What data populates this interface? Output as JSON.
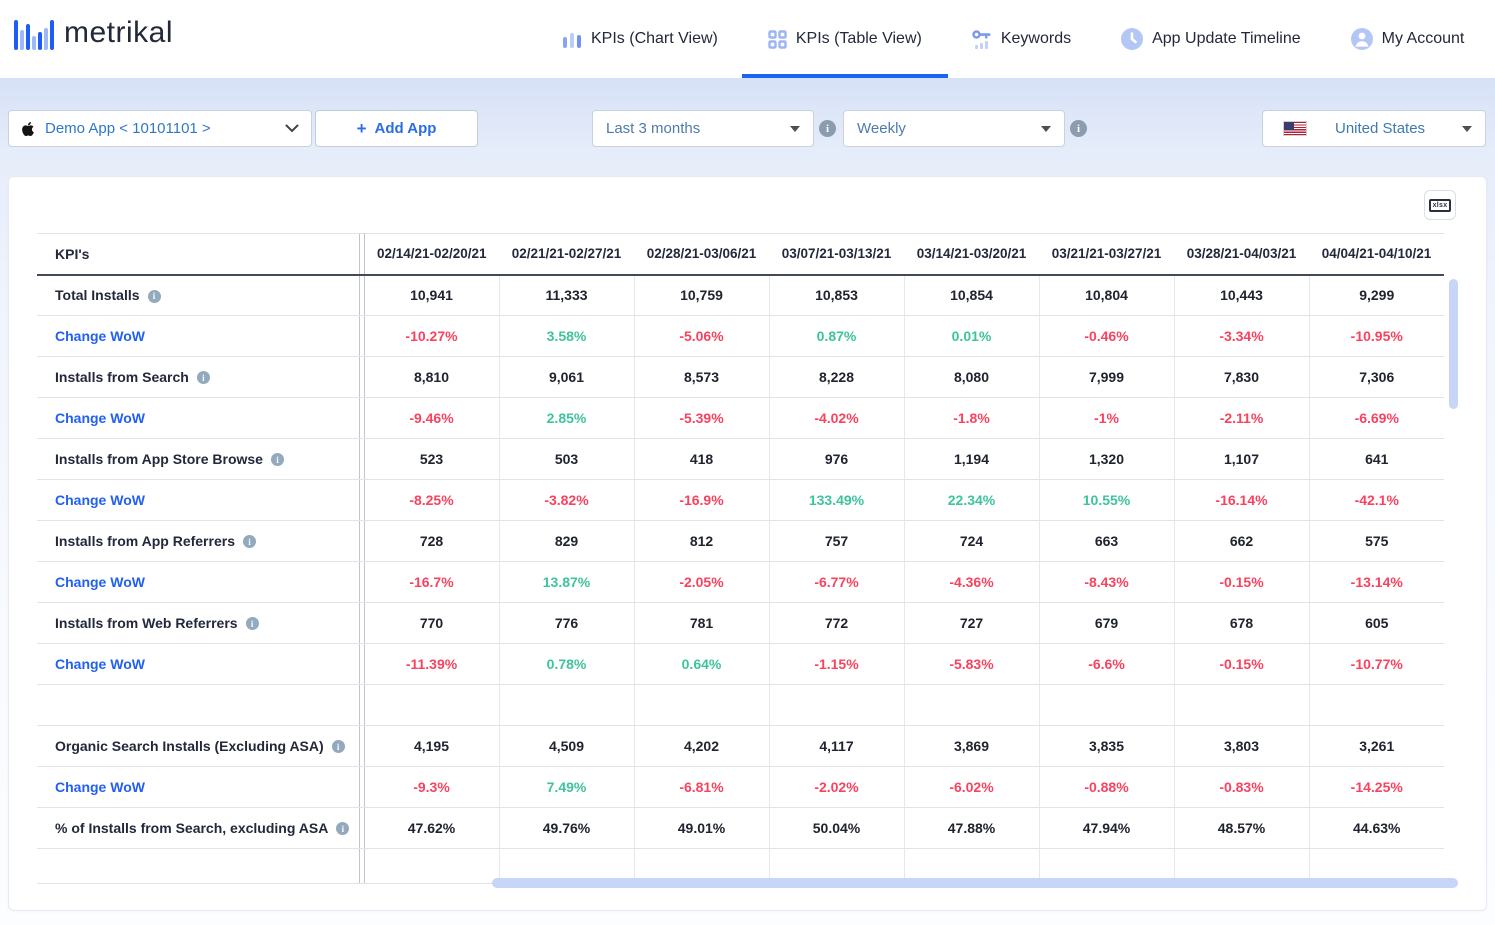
{
  "colors": {
    "accent": "#1b63f2",
    "link": "#2160f0",
    "positive": "#3ec49c",
    "negative": "#f8435f"
  },
  "brand": {
    "name": "metrikal",
    "logo_icon": "bar-chart-logo-icon"
  },
  "nav": {
    "items": [
      {
        "label": "KPIs (Chart View)",
        "icon": "bar-chart-icon",
        "active": false
      },
      {
        "label": "KPIs (Table View)",
        "icon": "grid-icon",
        "active": true
      },
      {
        "label": "Keywords",
        "icon": "key-icon",
        "active": false
      },
      {
        "label": "App Update Timeline",
        "icon": "clock-icon",
        "active": false
      },
      {
        "label": "My Account",
        "icon": "user-icon",
        "active": false
      }
    ]
  },
  "toolbar": {
    "app_selector": {
      "value": "Demo App < 10101101 >",
      "icon": "apple-icon"
    },
    "add_app": {
      "plus": "+",
      "label": "Add App"
    },
    "date_range": {
      "value": "Last 3 months",
      "info_icon": "info-icon"
    },
    "granularity": {
      "value": "Weekly",
      "info_icon": "info-icon"
    },
    "country": {
      "value": "United States",
      "icon": "us-flag-icon"
    },
    "export": {
      "icon": "xlsx-export-icon",
      "glyph": "xlsx"
    }
  },
  "table": {
    "kpi_header": "KPI's",
    "columns": [
      "02/14/21-02/20/21",
      "02/21/21-02/27/21",
      "02/28/21-03/06/21",
      "03/07/21-03/13/21",
      "03/14/21-03/20/21",
      "03/21/21-03/27/21",
      "03/28/21-04/03/21",
      "04/04/21-04/10/21"
    ],
    "rows": [
      {
        "type": "kpi",
        "label": "Total Installs",
        "info": true,
        "values": [
          "10,941",
          "11,333",
          "10,759",
          "10,853",
          "10,854",
          "10,804",
          "10,443",
          "9,299"
        ]
      },
      {
        "type": "change",
        "label": "Change WoW",
        "values": [
          "-10.27%",
          "3.58%",
          "-5.06%",
          "0.87%",
          "0.01%",
          "-0.46%",
          "-3.34%",
          "-10.95%"
        ]
      },
      {
        "type": "kpi",
        "label": "Installs from Search",
        "info": true,
        "values": [
          "8,810",
          "9,061",
          "8,573",
          "8,228",
          "8,080",
          "7,999",
          "7,830",
          "7,306"
        ]
      },
      {
        "type": "change",
        "label": "Change WoW",
        "values": [
          "-9.46%",
          "2.85%",
          "-5.39%",
          "-4.02%",
          "-1.8%",
          "-1%",
          "-2.11%",
          "-6.69%"
        ]
      },
      {
        "type": "kpi",
        "label": "Installs from App Store Browse",
        "info": true,
        "values": [
          "523",
          "503",
          "418",
          "976",
          "1,194",
          "1,320",
          "1,107",
          "641"
        ]
      },
      {
        "type": "change",
        "label": "Change WoW",
        "values": [
          "-8.25%",
          "-3.82%",
          "-16.9%",
          "133.49%",
          "22.34%",
          "10.55%",
          "-16.14%",
          "-42.1%"
        ]
      },
      {
        "type": "kpi",
        "label": "Installs from App Referrers",
        "info": true,
        "values": [
          "728",
          "829",
          "812",
          "757",
          "724",
          "663",
          "662",
          "575"
        ]
      },
      {
        "type": "change",
        "label": "Change WoW",
        "values": [
          "-16.7%",
          "13.87%",
          "-2.05%",
          "-6.77%",
          "-4.36%",
          "-8.43%",
          "-0.15%",
          "-13.14%"
        ]
      },
      {
        "type": "kpi",
        "label": "Installs from Web Referrers",
        "info": true,
        "values": [
          "770",
          "776",
          "781",
          "772",
          "727",
          "679",
          "678",
          "605"
        ]
      },
      {
        "type": "change",
        "label": "Change WoW",
        "values": [
          "-11.39%",
          "0.78%",
          "0.64%",
          "-1.15%",
          "-5.83%",
          "-6.6%",
          "-0.15%",
          "-10.77%"
        ]
      },
      {
        "type": "empty",
        "label": "",
        "values": [
          "",
          "",
          "",
          "",
          "",
          "",
          "",
          ""
        ]
      },
      {
        "type": "kpi",
        "label": "Organic Search Installs (Excluding ASA)",
        "info": true,
        "values": [
          "4,195",
          "4,509",
          "4,202",
          "4,117",
          "3,869",
          "3,835",
          "3,803",
          "3,261"
        ]
      },
      {
        "type": "change",
        "label": "Change WoW",
        "values": [
          "-9.3%",
          "7.49%",
          "-6.81%",
          "-2.02%",
          "-6.02%",
          "-0.88%",
          "-0.83%",
          "-14.25%"
        ]
      },
      {
        "type": "kpi",
        "label": "% of Installs from Search, excluding ASA",
        "info": true,
        "values": [
          "47.62%",
          "49.76%",
          "49.01%",
          "50.04%",
          "47.88%",
          "47.94%",
          "48.57%",
          "44.63%"
        ]
      },
      {
        "type": "empty-end",
        "label": "",
        "values": [
          "",
          "",
          "",
          "",
          "",
          "",
          "",
          ""
        ]
      }
    ]
  }
}
